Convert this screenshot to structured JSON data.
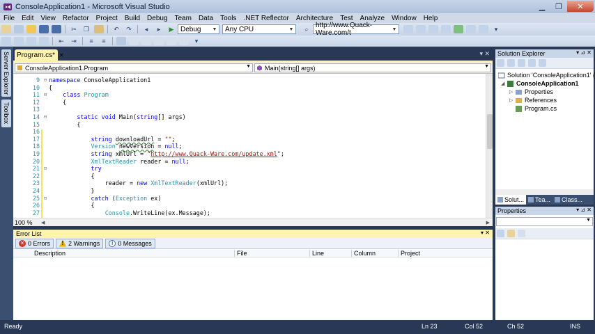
{
  "window": {
    "title": "ConsoleApplication1 - Microsoft Visual Studio"
  },
  "menu": [
    "File",
    "Edit",
    "View",
    "Refactor",
    "Project",
    "Build",
    "Debug",
    "Team",
    "Data",
    "Tools",
    ".NET Reflector",
    "Architecture",
    "Test",
    "Analyze",
    "Window",
    "Help"
  ],
  "toolbar": {
    "config": "Debug",
    "platform": "Any CPU",
    "find_value": "http://www.Quack-Ware.com/t"
  },
  "left_tabs": [
    "Server Explorer",
    "Toolbox"
  ],
  "doc_tab": {
    "label": "Program.cs*"
  },
  "nav": {
    "type": "ConsoleApplication1.Program",
    "member": "Main(string[] args)"
  },
  "code_lines": [
    {
      "num": "9",
      "fold": "⊟",
      "html": "<span class=\"kw\">namespace</span> ConsoleApplication1"
    },
    {
      "num": "10",
      "fold": "",
      "html": "{"
    },
    {
      "num": "11",
      "fold": "⊟",
      "html": "    <span class=\"kw\">class</span> <span class=\"ty\">Program</span>"
    },
    {
      "num": "12",
      "fold": "",
      "html": "    {"
    },
    {
      "num": "13",
      "fold": "",
      "html": ""
    },
    {
      "num": "14",
      "fold": "⊟",
      "html": "        <span class=\"kw\">static</span> <span class=\"kw\">void</span> Main(<span class=\"kw\">string</span>[] args)"
    },
    {
      "num": "15",
      "fold": "",
      "html": "        {"
    },
    {
      "num": "16",
      "fold": "",
      "html": ""
    },
    {
      "num": "17",
      "fold": "",
      "html": "            <span class=\"kw\">string</span> <span class=\"sq\">downloadUrl</span> = <span class=\"str\">\"\"</span>;"
    },
    {
      "num": "18",
      "fold": "",
      "html": "            <span class=\"ty\">Version</span> <span class=\"sq\">newVersion</span> = <span class=\"kw\">null</span>;"
    },
    {
      "num": "19",
      "fold": "",
      "html": "            <span class=\"kw\">string</span> xmlUrl = <span class=\"str\">\"<span class=\"url\">http://www.Quack-Ware.com/update.xml</span>\"</span>;"
    },
    {
      "num": "20",
      "fold": "",
      "html": "            <span class=\"ty\">XmlTextReader</span> reader = <span class=\"kw\">null</span>;"
    },
    {
      "num": "21",
      "fold": "⊟",
      "html": "            <span class=\"kw\">try</span>"
    },
    {
      "num": "22",
      "fold": "",
      "html": "            {"
    },
    {
      "num": "23",
      "fold": "",
      "html": "                reader = <span class=\"kw\">new</span> <span class=\"ty\">XmlTextReader</span>(xmlUrl);"
    },
    {
      "num": "24",
      "fold": "",
      "html": "            }"
    },
    {
      "num": "25",
      "fold": "⊟",
      "html": "            <span class=\"kw\">catch</span> (<span class=\"ty\">Exception</span> ex)"
    },
    {
      "num": "26",
      "fold": "",
      "html": "            {"
    },
    {
      "num": "27",
      "fold": "",
      "html": "                <span class=\"ty\">Console</span>.WriteLine(ex.Message);"
    }
  ],
  "editor": {
    "zoom": "100 %"
  },
  "error_list": {
    "title": "Error List",
    "errors": "0 Errors",
    "warnings": "2 Warnings",
    "messages": "0 Messages",
    "columns": [
      "Description",
      "File",
      "Line",
      "Column",
      "Project"
    ]
  },
  "solution_explorer": {
    "title": "Solution Explorer",
    "tree": [
      "Solution 'ConsoleApplication1' (",
      "ConsoleApplication1",
      "Properties",
      "References",
      "Program.cs"
    ],
    "tabs": [
      "Solut...",
      "Tea...",
      "Class..."
    ]
  },
  "properties": {
    "title": "Properties"
  },
  "status": {
    "ready": "Ready",
    "line": "Ln 23",
    "col": "Col 52",
    "ch": "Ch 52",
    "ins": "INS"
  },
  "colors": {
    "frame": "#293955",
    "active_tab": "#fff3b0",
    "keyword": "#0000ff",
    "type": "#2b91af",
    "string": "#a31515"
  }
}
